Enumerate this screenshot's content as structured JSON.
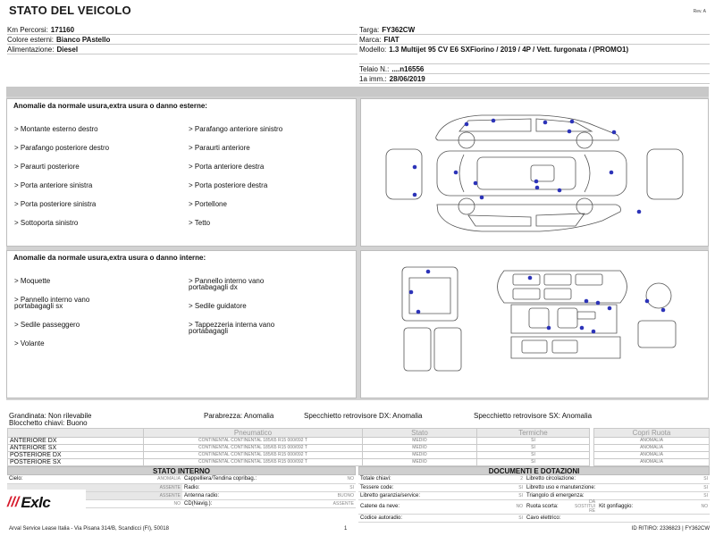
{
  "header": {
    "title": "STATO DEL VEICOLO",
    "rev": "Rev. A"
  },
  "vehicle_left": [
    {
      "label": "Km Percorsi:",
      "value": "171160"
    },
    {
      "label": "Colore esterni:",
      "value": "Bianco PAstello"
    },
    {
      "label": "Alimentazione:",
      "value": "Diesel"
    }
  ],
  "vehicle_right": {
    "targa": {
      "label": "Targa:",
      "value": "FY362CW"
    },
    "marca": {
      "label": "Marca:",
      "value": "FIAT"
    },
    "modello": {
      "label": "Modello:",
      "value": "1.3 Multijet 95 CV E6 SXFiorino / 2019 / 4P / Vett. furgonata / (PROMO1)"
    },
    "telaio": {
      "label": "Telaio N.:",
      "value": "....n16556"
    },
    "imm": {
      "label": "1a imm.:",
      "value": "28/06/2019"
    }
  },
  "external_damage": {
    "heading": "Anomalie da normale usura,extra usura o danno esterne:",
    "col1": [
      "> Montante esterno destro",
      "> Parafango posteriore destro",
      "> Paraurti posteriore",
      "> Porta anteriore sinistra",
      "> Porta posteriore sinistra",
      "> Sottoporta sinistro"
    ],
    "col2": [
      "> Parafango anteriore sinistro",
      "> Paraurti anteriore",
      "> Porta anteriore destra",
      "> Porta posteriore destra",
      "> Portellone",
      "> Tetto"
    ]
  },
  "internal_damage": {
    "heading": "Anomalie da normale usura,extra usura o danno interne:",
    "col1": [
      "> Moquette",
      "> Pannello interno vano\nportabagagli sx",
      "> Sedile passeggero",
      "> Volante"
    ],
    "col2": [
      "> Pannello interno vano\nportabagagli dx",
      "> Sedile guidatore",
      "> Tappezzeria interna vano\nportabagagli"
    ]
  },
  "glass": {
    "grandinata": "Grandinata: Non rilevabile",
    "bloccchetto": "Blocchetto chiavi: Buono",
    "parabrezza": "Parabrezza: Anomalia",
    "specchio_dx": "Specchietto retrovisore DX: Anomalia",
    "specchio_sx": "Specchietto retrovisore SX: Anomalia"
  },
  "tyres": {
    "headers": [
      "",
      "Pneumatico",
      "Stato",
      "Termiche"
    ],
    "rows": [
      {
        "pos": "ANTERIORE DX",
        "tyre": "CONTINENTAL CONTINENTAL  185/65 R15 000/092 T",
        "stato": "MEDIO",
        "term": "SI"
      },
      {
        "pos": "ANTERIORE SX",
        "tyre": "CONTINENTAL CONTINENTAL  185/65 R15 000/092 T",
        "stato": "MEDIO",
        "term": "SI"
      },
      {
        "pos": "POSTERIORE DX",
        "tyre": "CONTINENTAL CONTINENTAL  185/65 R15 000/092 T",
        "stato": "MEDIO",
        "term": "SI"
      },
      {
        "pos": "POSTERIORE SX",
        "tyre": "CONTINENTAL CONTINENTAL  185/65 R15 000/092 T",
        "stato": "MEDIO",
        "term": "SI"
      }
    ]
  },
  "copri": {
    "header": "Copri Ruota",
    "rows": [
      "ANOMALIA",
      "ANOMALIA",
      "ANOMALIA",
      "ANOMALIA"
    ]
  },
  "stato_interno": {
    "title": "STATO INTERNO",
    "rows": [
      {
        "l1": "Cielo:",
        "v1": "ANOMALIA",
        "l2": "Cappelliera/Tendina copribag.:",
        "v2": "NO"
      },
      {
        "l1": "",
        "v1": "ASSENTE",
        "l2": "Radio:",
        "v2": "SI"
      },
      {
        "l1": "",
        "v1": "ASSENTE",
        "l2": "Antenna radio:",
        "v2": "BUONO"
      },
      {
        "l1": "",
        "v1": "NO",
        "l2": "CD(Navig.):",
        "v2": "ASSENTE"
      }
    ]
  },
  "documenti": {
    "title": "DOCUMENTI E DOTAZIONI",
    "rows": [
      {
        "l1": "Totale chiavi:",
        "v1": "2",
        "l2": "Libretto circolazione:",
        "v2": "SI"
      },
      {
        "l1": "Tessere code:",
        "v1": "SI",
        "l2": "Libretto uso e manutenzione:",
        "v2": "SI"
      },
      {
        "l1": "Libretto garanzia/service:",
        "v1": "SI",
        "l2": "Triangolo di emergenza:",
        "v2": "SI"
      },
      {
        "l1": "Catene da neve:",
        "v1": "NO",
        "l2": "Ruota scorta:",
        "v2": "DA SOSTITUI RE",
        "l3": "Kit gonfiaggio:",
        "v3": "NO"
      },
      {
        "l1": "Codice autoradio:",
        "v1": "SI",
        "l2": "Cavo elettrico:",
        "v2": ""
      }
    ]
  },
  "logo": {
    "mark": "///",
    "text": "Exlc"
  },
  "footer": {
    "company": "Arval Service Lease Italia - Via Pisana 314/B, Scandicci (FI), 50018",
    "page": "1",
    "id": "ID RITIRO: 2336823 | FY362CW"
  },
  "colors": {
    "damage_dot": "#2c33b8",
    "band": "#c8c8c8",
    "logo_red": "#d6182a"
  }
}
